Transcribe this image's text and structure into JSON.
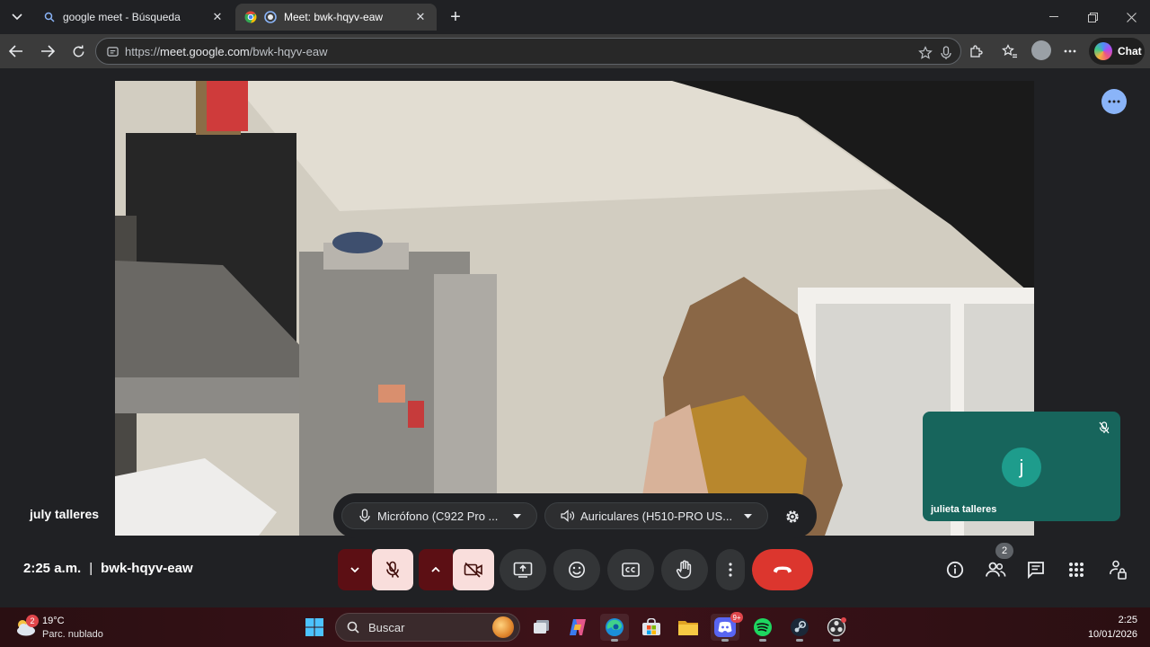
{
  "browser": {
    "tabs": [
      {
        "title": "google meet - Búsqueda",
        "active": false,
        "icon": "search-icon"
      },
      {
        "title": "Meet: bwk-hqyv-eaw",
        "active": true,
        "icon": "meet-icon"
      }
    ],
    "url": {
      "scheme": "https://",
      "host": "meet.google.com",
      "path": "/bwk-hqyv-eaw"
    },
    "chat_label": "Chat"
  },
  "meet": {
    "main_participant": "july talleres",
    "self_tile": {
      "initial": "j",
      "name": "julieta talleres",
      "muted": true,
      "color": "#17655c"
    },
    "devices": {
      "microphone": "Micrófono (C922 Pro ...",
      "speakers": "Auriculares (H510-PRO US..."
    },
    "time": "2:25 a.m.",
    "separator": "|",
    "meeting_code": "bwk-hqyv-eaw",
    "participants_count": "2",
    "end_call_color": "#dc362e",
    "accent": "#8ab4f8"
  },
  "taskbar": {
    "weather": {
      "temp": "19°C",
      "condition": "Parc. nublado",
      "badge": "2"
    },
    "search_placeholder": "Buscar",
    "discord_badge": "9+",
    "time": "2:25",
    "date": "10/01/2026"
  }
}
